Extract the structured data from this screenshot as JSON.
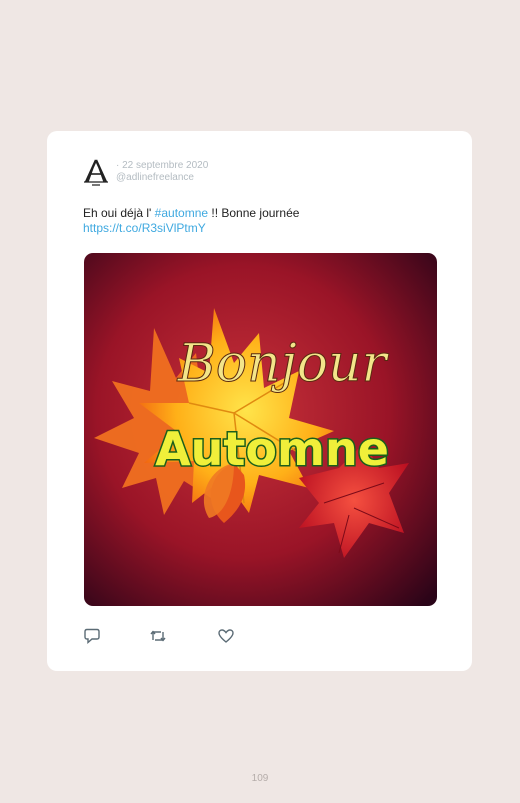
{
  "tweet": {
    "date": "· 22 septembre 2020",
    "handle": "@adlinefreelance",
    "text_prefix": "Eh oui déjà l' ",
    "hashtag": "#automne",
    "text_suffix": " !! Bonne journée",
    "link": "https://t.co/R3siVlPtmY",
    "image": {
      "line1": "Bonjour",
      "line2": "Automne",
      "description_colors": {
        "background": "#8c1020",
        "title": "#f3e58a",
        "subtitle_fill": "#f0ef3a",
        "subtitle_outline": "#1b5e1b"
      }
    },
    "actions": {
      "reply_icon": "reply-icon",
      "retweet_icon": "retweet-icon",
      "like_icon": "heart-icon"
    }
  },
  "page": {
    "number": "109"
  },
  "colors": {
    "background": "#efe7e4",
    "card": "#ffffff",
    "link": "#3fa9e0",
    "meta": "#b4bcc2"
  }
}
